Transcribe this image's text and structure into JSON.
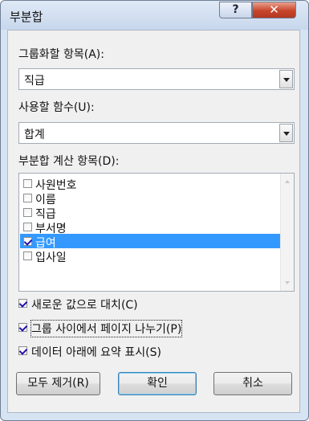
{
  "window": {
    "title": "부분합",
    "help_label": "?",
    "close_label": "✕"
  },
  "group_by": {
    "label": "그룹화할 항목(A):",
    "value": "직급"
  },
  "function": {
    "label": "사용할 함수(U):",
    "value": "합계"
  },
  "subtotal_fields": {
    "label": "부분합 계산 항목(D):",
    "items": [
      {
        "label": "사원번호",
        "checked": false,
        "selected": false
      },
      {
        "label": "이름",
        "checked": false,
        "selected": false
      },
      {
        "label": "직급",
        "checked": false,
        "selected": false
      },
      {
        "label": "부서명",
        "checked": false,
        "selected": false
      },
      {
        "label": "급여",
        "checked": true,
        "selected": true
      },
      {
        "label": "입사일",
        "checked": false,
        "selected": false
      }
    ]
  },
  "options": [
    {
      "label": "새로운 값으로 대치(C)",
      "checked": true
    },
    {
      "label": "그룹 사이에서 페이지 나누기(P)",
      "checked": true
    },
    {
      "label": "데이터 아래에 요약 표시(S)",
      "checked": true
    }
  ],
  "buttons": {
    "remove_all": "모두 제거(R)",
    "ok": "확인",
    "cancel": "취소"
  },
  "icons": {
    "help": "help-icon",
    "close": "close-icon",
    "dropdown": "chevron-down-icon",
    "checkbox": "checkmark-icon"
  }
}
